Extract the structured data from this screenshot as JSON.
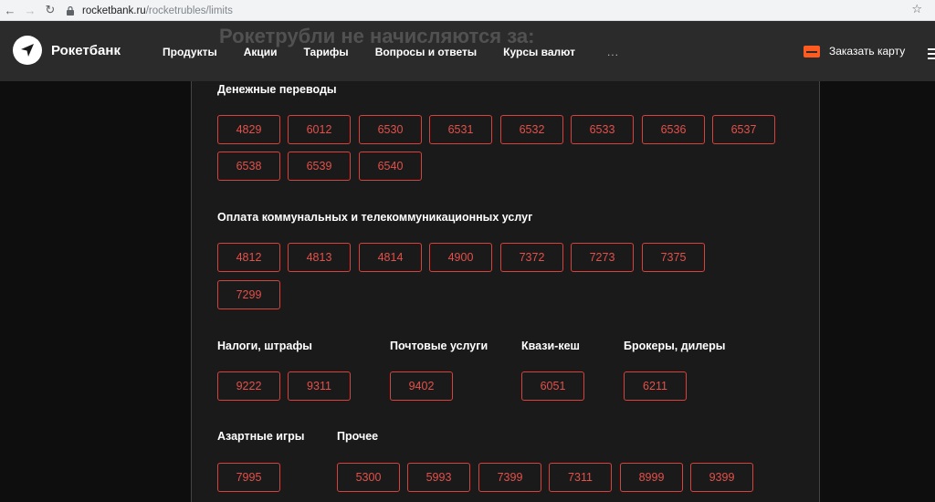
{
  "browser": {
    "url_host": "rocketbank.ru",
    "url_path": "/rocketrubles/limits"
  },
  "header": {
    "brand": "Рокетбанк",
    "ghost_title": "Рокетрубли не начисляются за:",
    "nav": [
      "Продукты",
      "Акции",
      "Тарифы",
      "Вопросы и ответы",
      "Курсы валют"
    ],
    "nav_more": "...",
    "order_card": "Заказать карту"
  },
  "sections": {
    "transfers": {
      "title": "Денежные переводы",
      "codes": [
        "4829",
        "6012",
        "6530",
        "6531",
        "6532",
        "6533",
        "6536",
        "6537",
        "6538",
        "6539",
        "6540"
      ]
    },
    "utilities": {
      "title": "Оплата коммунальных и телекоммуникационных услуг",
      "codes": [
        "4812",
        "4813",
        "4814",
        "4900",
        "7372",
        "7273",
        "7375",
        "7299"
      ]
    },
    "taxes": {
      "title": "Налоги, штрафы",
      "codes": [
        "9222",
        "9311"
      ]
    },
    "postal": {
      "title": "Почтовые услуги",
      "codes": [
        "9402"
      ]
    },
    "quasi_cash": {
      "title": "Квази-кеш",
      "codes": [
        "6051"
      ]
    },
    "brokers": {
      "title": "Брокеры, дилеры",
      "codes": [
        "6211"
      ]
    },
    "gambling": {
      "title": "Азартные игры",
      "codes": [
        "7995"
      ]
    },
    "other": {
      "title": "Прочее",
      "codes": [
        "5300",
        "5993",
        "7399",
        "7311",
        "8999",
        "9399"
      ]
    }
  },
  "colors": {
    "accent": "#e4504a",
    "header_bg": "#2b2b2b",
    "page_bg": "#1a1a1a",
    "order_icon": "#ff5a1f"
  }
}
